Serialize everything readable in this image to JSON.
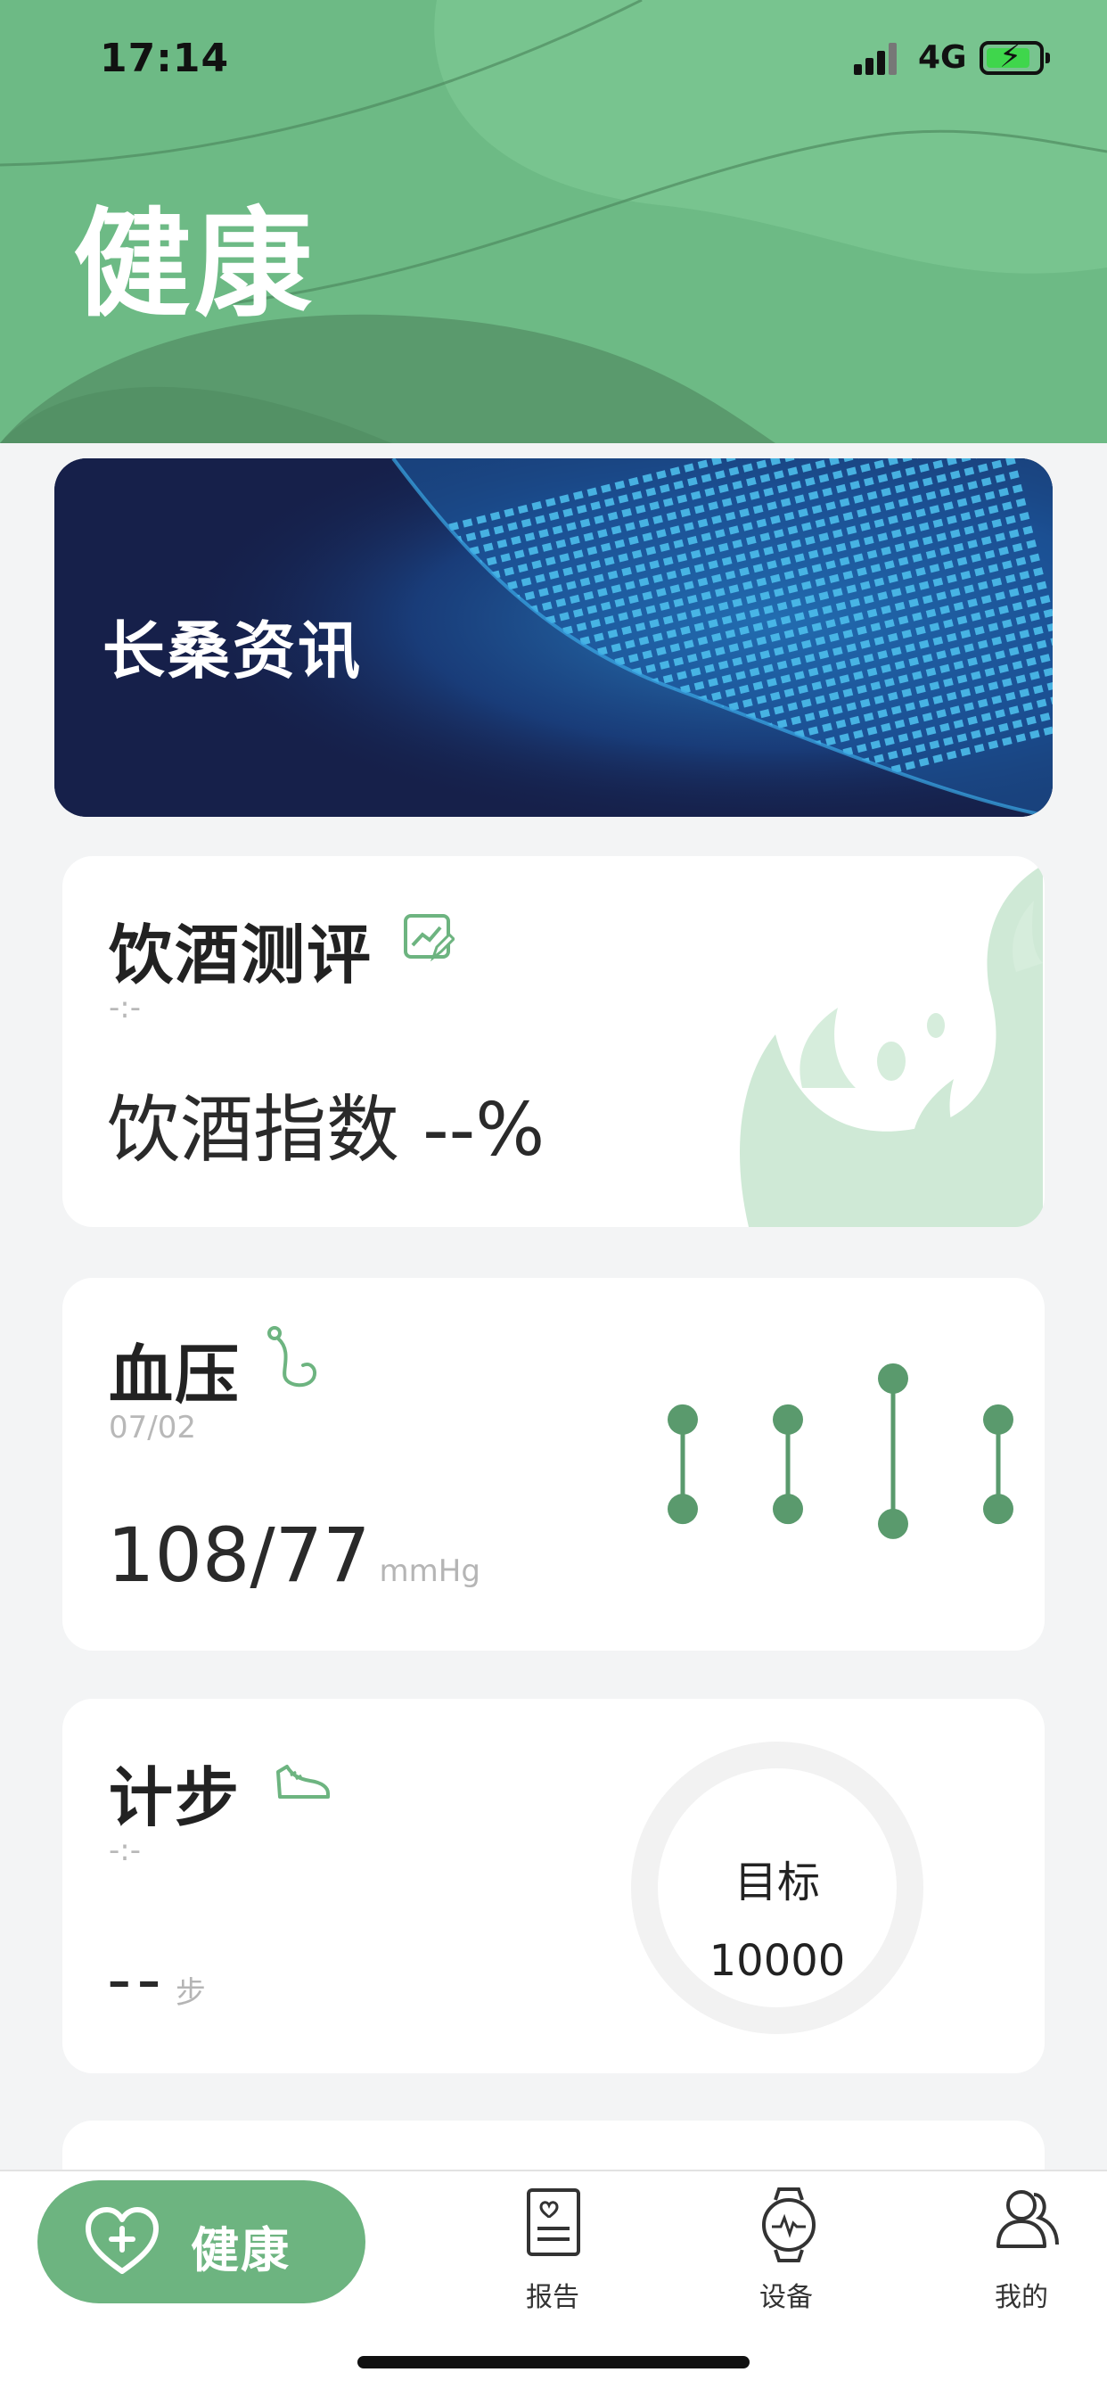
{
  "status_bar": {
    "time": "17:14",
    "network": "4G"
  },
  "header": {
    "title": "健康"
  },
  "banner": {
    "title": "长桑资讯"
  },
  "drinking": {
    "title": "饮酒测评",
    "date": "-:-",
    "index_label": "饮酒指数",
    "index_value": "--%"
  },
  "blood_pressure": {
    "title": "血压",
    "date": "07/02",
    "value": "108/77",
    "unit": "mmHg",
    "history_level": [
      {
        "high": 0.62,
        "low": 0.38
      },
      {
        "high": 0.62,
        "low": 0.38
      },
      {
        "high": 0.73,
        "low": 0.34
      },
      {
        "high": 0.62,
        "low": 0.38
      }
    ]
  },
  "steps": {
    "title": "计步",
    "date": "-:-",
    "value": "--",
    "unit": "步",
    "goal_label": "目标",
    "goal_value": "10000"
  },
  "tabbar": {
    "health": "健康",
    "report": "报告",
    "device": "设备",
    "mine": "我的"
  },
  "colors": {
    "primary": "#6db480",
    "dark_green": "#5a9a6d",
    "banner_bg": "#16204a"
  }
}
